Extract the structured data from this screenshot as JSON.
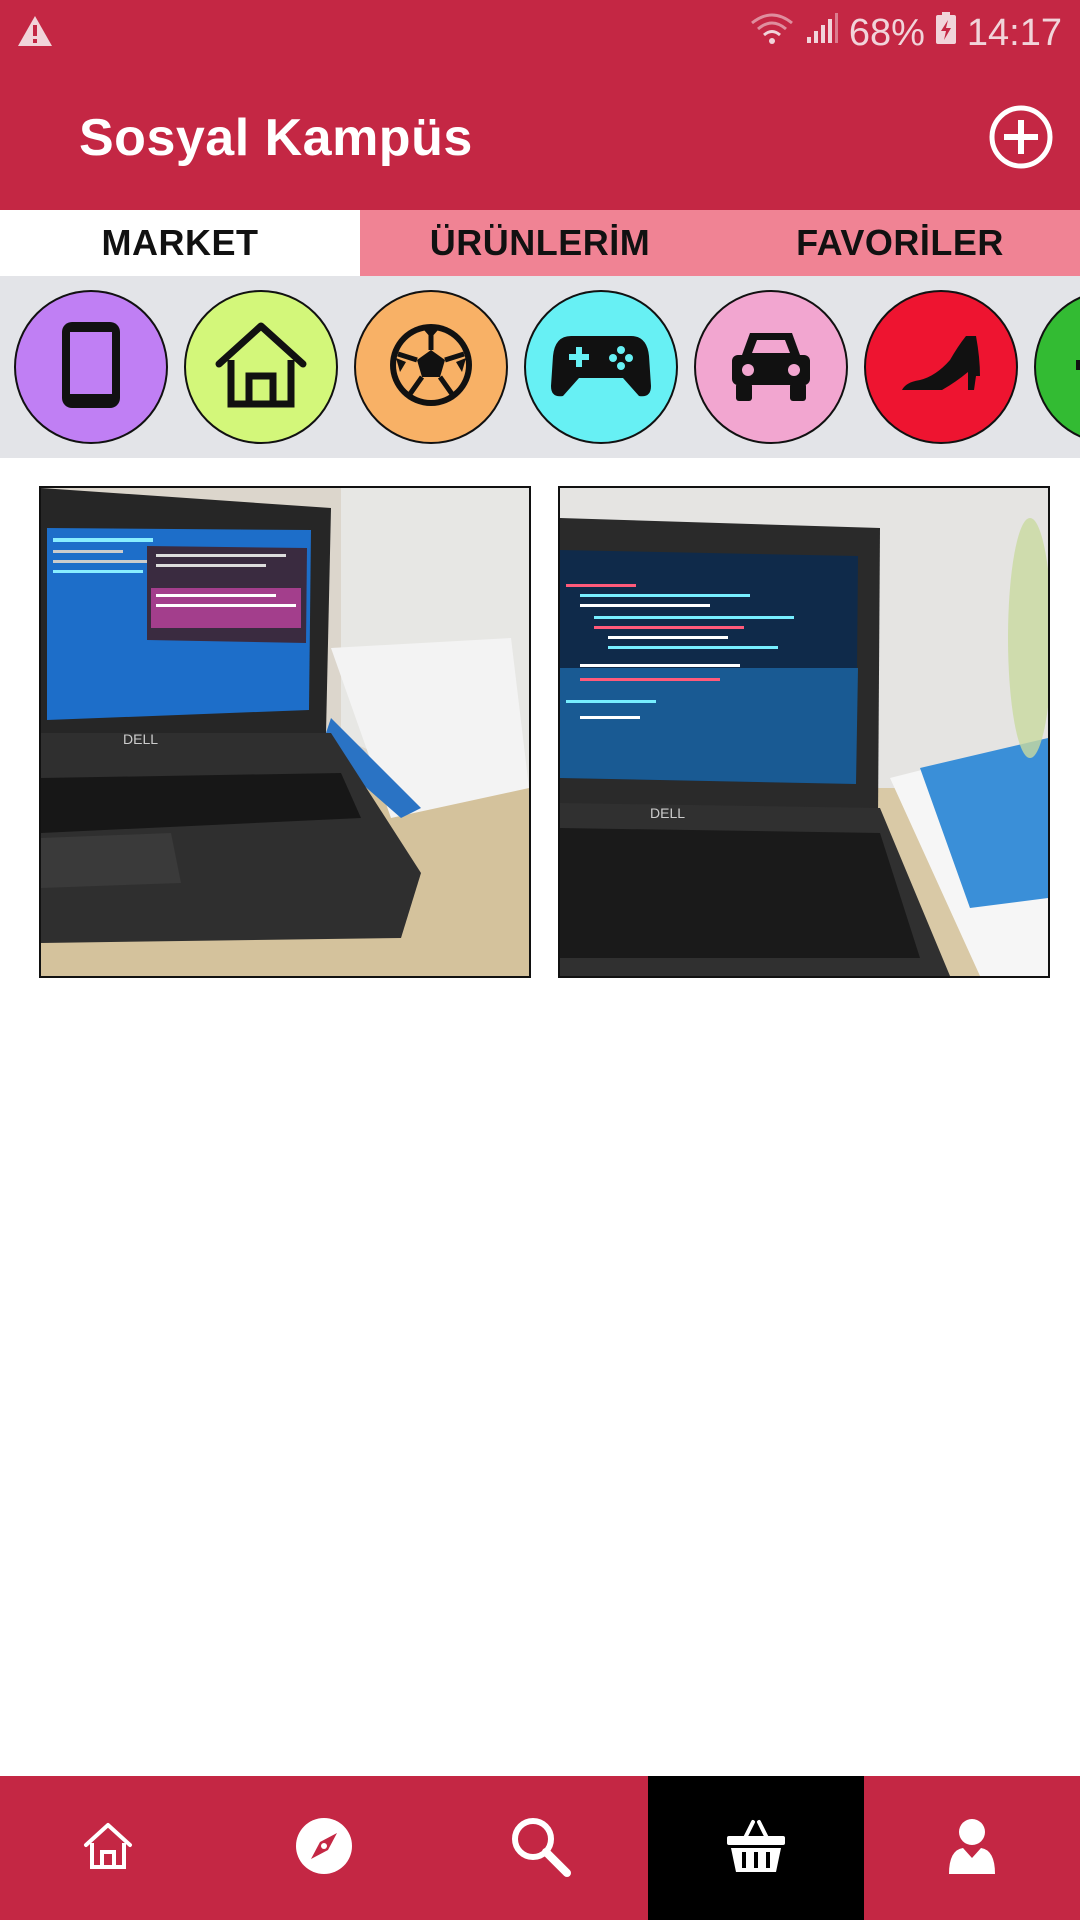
{
  "status": {
    "battery": "68%",
    "time": "14:17",
    "icons": [
      "warning-icon",
      "wifi-icon",
      "signal-icon",
      "battery-charging-icon"
    ]
  },
  "app": {
    "title": "Sosyal Kampüs",
    "add_icon": "plus-circle-icon"
  },
  "tabs": [
    {
      "label": "MARKET",
      "active": true
    },
    {
      "label": "ÜRÜNLERİM",
      "active": false
    },
    {
      "label": "FAVORİLER",
      "active": false
    }
  ],
  "categories": [
    {
      "icon": "phone-icon",
      "color": "#c07ff4"
    },
    {
      "icon": "home-icon",
      "color": "#d3f77a"
    },
    {
      "icon": "soccer-ball-icon",
      "color": "#f8b166"
    },
    {
      "icon": "gamepad-icon",
      "color": "#67f0f4"
    },
    {
      "icon": "car-icon",
      "color": "#f2a6d0"
    },
    {
      "icon": "high-heel-icon",
      "color": "#ee1430"
    },
    {
      "icon": "plus-icon",
      "color": "#33bb33"
    }
  ],
  "products": [
    {
      "image": "laptop-photo-1"
    },
    {
      "image": "laptop-photo-2"
    }
  ],
  "bottom_nav": [
    {
      "icon": "home-icon",
      "active": false
    },
    {
      "icon": "compass-icon",
      "active": false
    },
    {
      "icon": "search-icon",
      "active": false
    },
    {
      "icon": "basket-icon",
      "active": true
    },
    {
      "icon": "user-icon",
      "active": false
    }
  ],
  "colors": {
    "primary": "#c42744",
    "tab_bg": "#f08394",
    "category_bar": "#e3e4e8",
    "nav_active": "#000000"
  }
}
